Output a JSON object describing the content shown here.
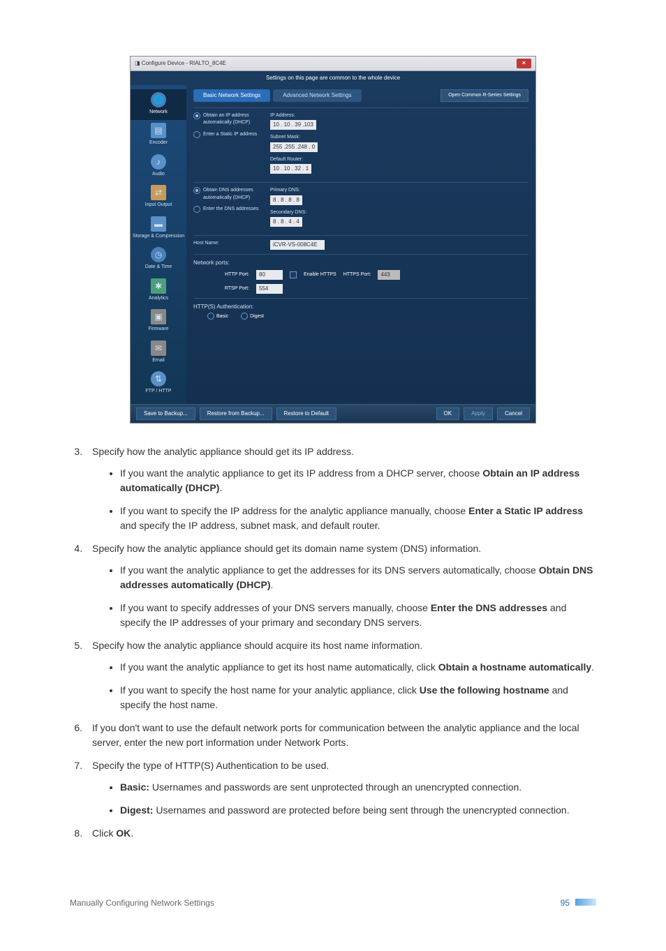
{
  "dialog": {
    "title": "Configure Device - RIALTO_8C4E",
    "banner": "Settings on this page are common to the whole device",
    "tabs": {
      "basic": "Basic Network Settings",
      "advanced": "Advanced Network Settings"
    },
    "common_btn": "Open Common R-Series Settings",
    "sidebar": [
      "Network",
      "Encoder",
      "Audio",
      "Input Output",
      "Storage & Compression",
      "Date & Time",
      "Analytics",
      "Firmware",
      "Email",
      "FTP / HTTP"
    ],
    "ip": {
      "r1": "Obtain an IP address automatically (DHCP)",
      "r2": "Enter a Static IP address",
      "ip_lbl": "IP Address:",
      "ip": "10 . 10 . 39 .103",
      "mask_lbl": "Subnet Mask:",
      "mask": "255 .255 .248 .  0",
      "router_lbl": "Default Router:",
      "router": "10 . 10 . 32 .  1"
    },
    "dns": {
      "r1": "Obtain DNS addresses automatically (DHCP)",
      "r2": "Enter the DNS addresses",
      "p_lbl": "Primary DNS:",
      "p": "8 .  8 .  8 .  8",
      "s_lbl": "Secondary DNS:",
      "s": "8 .  8 .  4 .  4"
    },
    "host": {
      "lbl": "Host Name:",
      "val": "iCVR-VS-008C4E"
    },
    "ports": {
      "heading": "Network ports:",
      "http_lbl": "HTTP Port:",
      "http": "80",
      "https_chk": "Enable HTTPS",
      "httpsp_lbl": "HTTPS Port:",
      "httpsp": "443",
      "rtsp_lbl": "RTSP Port:",
      "rtsp": "554"
    },
    "auth": {
      "heading": "HTTP(S) Authentication:",
      "basic": "Basic",
      "digest": "Digest"
    },
    "footer": {
      "save": "Save to Backup...",
      "restore": "Restore from Backup...",
      "default": "Restore to Default",
      "ok": "OK",
      "apply": "Apply",
      "cancel": "Cancel"
    }
  },
  "doc": {
    "s3": "Specify how the analytic appliance should get its IP address.",
    "s3a_pre": "If you want the analytic appliance to get its IP address from a DHCP server, choose ",
    "s3a_b": "Obtain an IP address automatically (DHCP)",
    "s3b_pre": "If you want to specify the IP address for the analytic appliance manually, choose ",
    "s3b_b": "Enter a Static IP address",
    "s3b_post": " and specify the IP address, subnet mask, and default router.",
    "s4": "Specify how the analytic appliance should get its domain name system (DNS) information.",
    "s4a_pre": "If you want the analytic appliance to get the addresses for its DNS servers automatically, choose ",
    "s4a_b": "Obtain DNS addresses automatically (DHCP)",
    "s4b_pre": "If you want to specify addresses of your DNS servers manually, choose ",
    "s4b_b": "Enter the DNS addresses",
    "s4b_post": " and specify the IP addresses of your primary and secondary DNS servers.",
    "s5": "Specify how the analytic appliance should acquire its host name information.",
    "s5a_pre": "If you want the analytic appliance to get its host name automatically, click ",
    "s5a_b": "Obtain a hostname automatically",
    "s5b_pre": "If you want to specify the host name for your analytic appliance, click ",
    "s5b_b": "Use the following hostname",
    "s5b_post": " and specify the host name.",
    "s6": "If you don't want to use the default network ports for communication between the analytic appliance and the local server, enter the new port information under Network Ports.",
    "s7": "Specify the type of HTTP(S) Authentication to be used.",
    "s7a_b": "Basic:",
    "s7a": " Usernames and passwords are sent unprotected through an unencrypted connection.",
    "s7b_b": "Digest:",
    "s7b": " Usernames and password are protected before being sent through the unencrypted connection.",
    "s8_pre": "Click ",
    "s8_b": "OK",
    "footer_title": "Manually Configuring Network Settings",
    "page": "95"
  }
}
